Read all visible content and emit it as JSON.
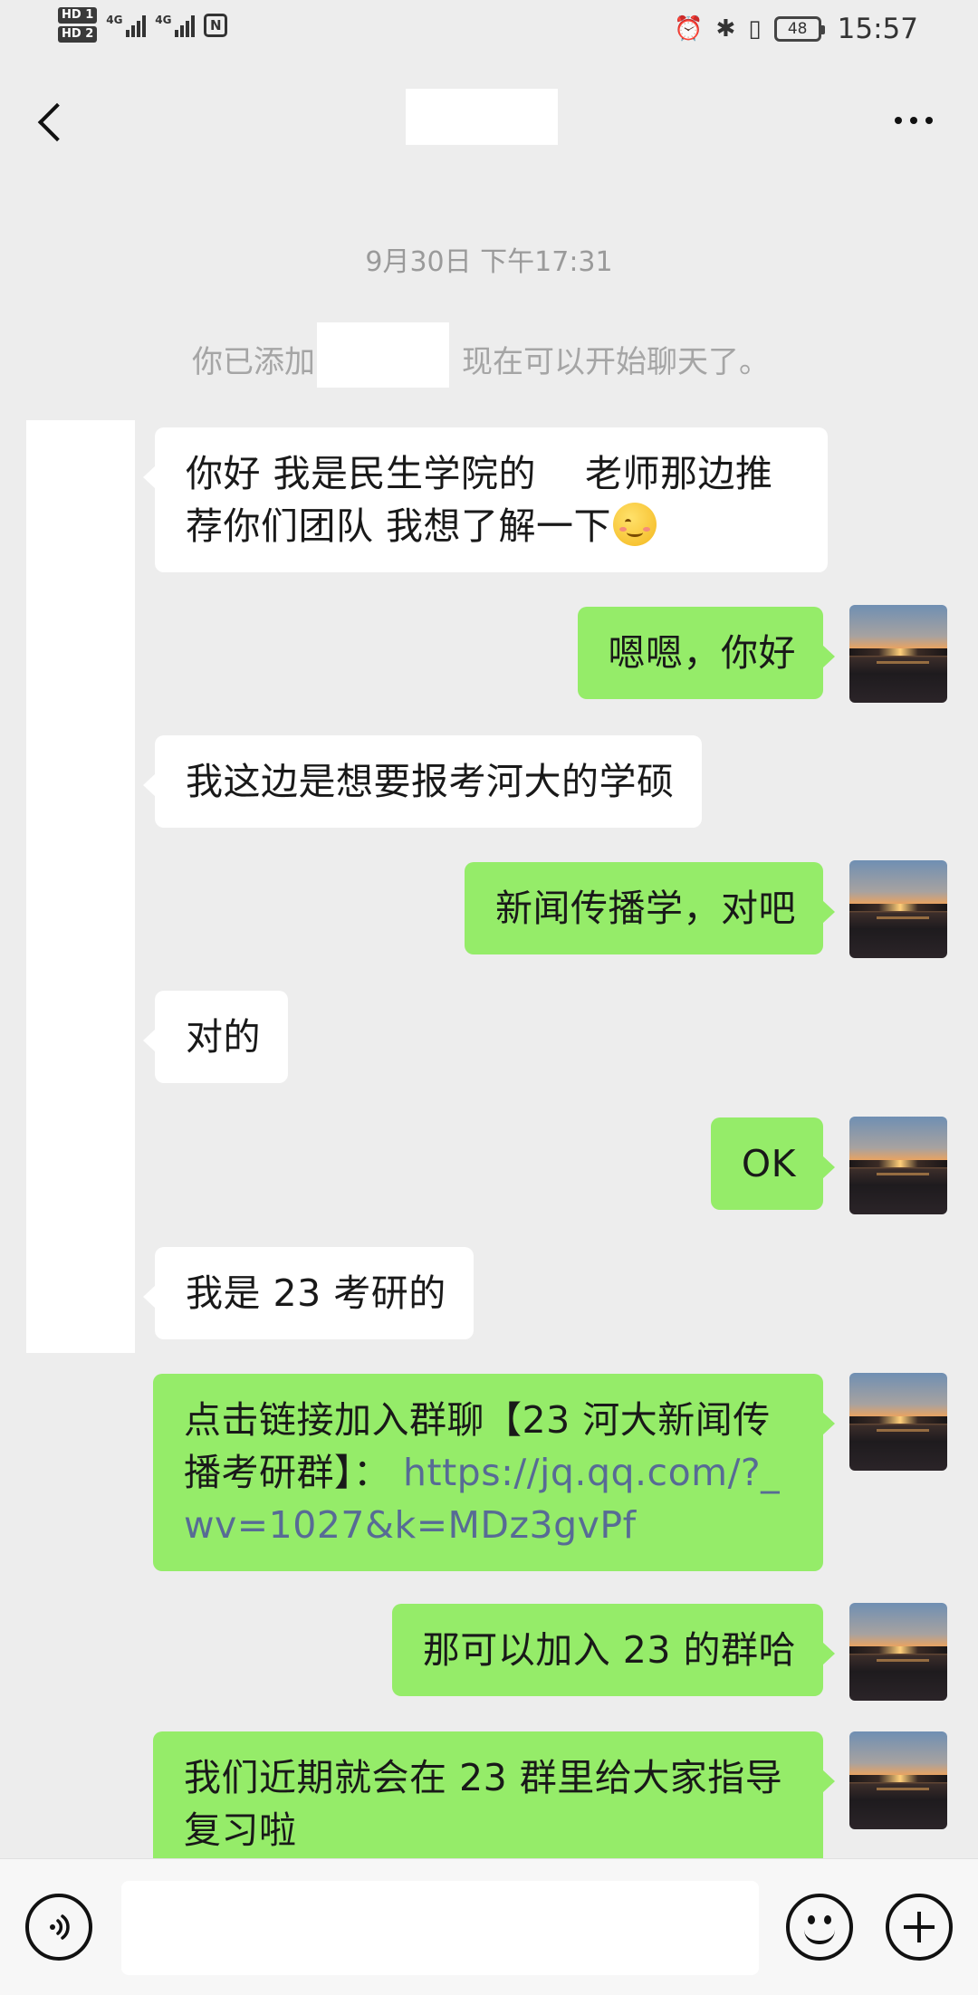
{
  "status_bar": {
    "sim1": "HD 1",
    "sim2": "HD 2",
    "net1": "4G",
    "net2": "4G",
    "nfc": "N",
    "battery": "48",
    "time": "15:57"
  },
  "chat": {
    "timestamp": "9月30日 下午17:31",
    "system_message_prefix": "你已添加",
    "system_message_suffix": "现在可以开始聊天了。",
    "messages": [
      {
        "side": "in",
        "text_a": "你好 我是民生学院的",
        "text_b": "老师那边推",
        "text_c": "荐你们团队 我想了解一下",
        "emoji": "smiling-face-icon"
      },
      {
        "side": "out",
        "text": "嗯嗯，你好"
      },
      {
        "side": "in",
        "text": "我这边是想要报考河大的学硕"
      },
      {
        "side": "out",
        "text": "新闻传播学，对吧"
      },
      {
        "side": "in",
        "text": "对的"
      },
      {
        "side": "out",
        "text": "OK"
      },
      {
        "side": "in",
        "text": "我是 23 考研的"
      },
      {
        "side": "out",
        "text_a": "点击链接加入群聊【23 河大新闻传",
        "text_b": "播考研群】：",
        "link_a": "https://jq.qq.com/?_",
        "link_b": "wv=1027&k=MDz3gvPf"
      },
      {
        "side": "out",
        "text": "那可以加入 23 的群哈"
      },
      {
        "side": "out",
        "text_a": "我们近期就会在 23 群里给大家指导",
        "text_b": "复习啦"
      }
    ]
  },
  "colors": {
    "background": "#ededed",
    "incoming_bubble": "#ffffff",
    "outgoing_bubble": "#95ec69",
    "link": "#576b95"
  }
}
